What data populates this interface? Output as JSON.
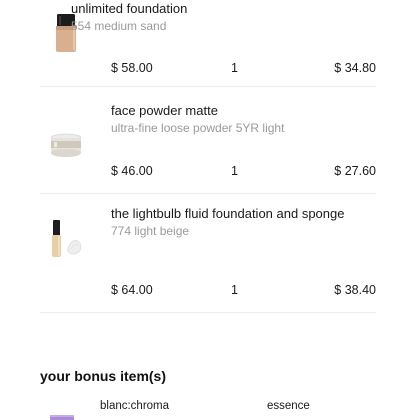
{
  "cart": {
    "items": [
      {
        "name": "unlimited foundation",
        "variant": "554 medium sand",
        "price": "$ 58.00",
        "quantity": "1",
        "total": "$ 34.80",
        "icon": "foundation-bottle-icon"
      },
      {
        "name": "face powder matte",
        "variant": "ultra-fine loose powder 5YR light",
        "price": "$ 46.00",
        "quantity": "1",
        "total": "$ 27.60",
        "icon": "powder-jar-icon"
      },
      {
        "name": "the lightbulb fluid foundation and sponge",
        "variant": "774 light beige",
        "price": "$ 64.00",
        "quantity": "1",
        "total": "$ 38.40",
        "icon": "fluid-foundation-sponge-icon"
      }
    ]
  },
  "bonus": {
    "heading": "your bonus item(s)",
    "items": [
      {
        "name": "blanc:chroma",
        "icon": "purple-jar-icon"
      },
      {
        "name": "essence",
        "icon": "black-bottle-icon"
      }
    ]
  }
}
